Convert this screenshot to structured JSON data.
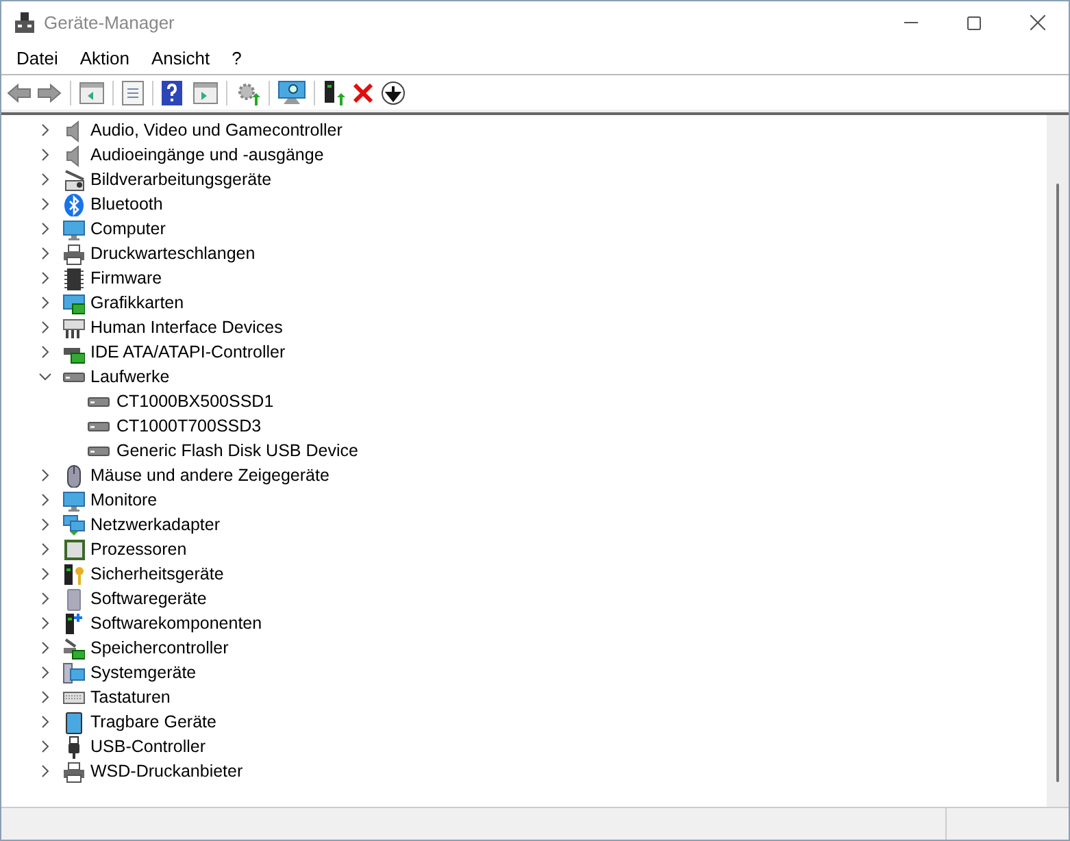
{
  "window": {
    "title": "Geräte-Manager"
  },
  "menu": [
    "Datei",
    "Aktion",
    "Ansicht",
    "?"
  ],
  "tree": [
    {
      "label": "Audio, Video und Gamecontroller",
      "expanded": false
    },
    {
      "label": "Audioeingänge und -ausgänge",
      "expanded": false
    },
    {
      "label": "Bildverarbeitungsgeräte",
      "expanded": false
    },
    {
      "label": "Bluetooth",
      "expanded": false
    },
    {
      "label": "Computer",
      "expanded": false
    },
    {
      "label": "Druckwarteschlangen",
      "expanded": false
    },
    {
      "label": "Firmware",
      "expanded": false
    },
    {
      "label": "Grafikkarten",
      "expanded": false
    },
    {
      "label": "Human Interface Devices",
      "expanded": false
    },
    {
      "label": "IDE ATA/ATAPI-Controller",
      "expanded": false
    },
    {
      "label": "Laufwerke",
      "expanded": true,
      "children": [
        {
          "label": "CT1000BX500SSD1"
        },
        {
          "label": "CT1000T700SSD3"
        },
        {
          "label": "Generic Flash Disk USB Device"
        }
      ]
    },
    {
      "label": "Mäuse und andere Zeigegeräte",
      "expanded": false
    },
    {
      "label": "Monitore",
      "expanded": false
    },
    {
      "label": "Netzwerkadapter",
      "expanded": false
    },
    {
      "label": "Prozessoren",
      "expanded": false
    },
    {
      "label": "Sicherheitsgeräte",
      "expanded": false
    },
    {
      "label": "Softwaregeräte",
      "expanded": false
    },
    {
      "label": "Softwarekomponenten",
      "expanded": false
    },
    {
      "label": "Speichercontroller",
      "expanded": false
    },
    {
      "label": "Systemgeräte",
      "expanded": false
    },
    {
      "label": "Tastaturen",
      "expanded": false
    },
    {
      "label": "Tragbare Geräte",
      "expanded": false
    },
    {
      "label": "USB-Controller",
      "expanded": false
    },
    {
      "label": "WSD-Druckanbieter",
      "expanded": false
    }
  ]
}
